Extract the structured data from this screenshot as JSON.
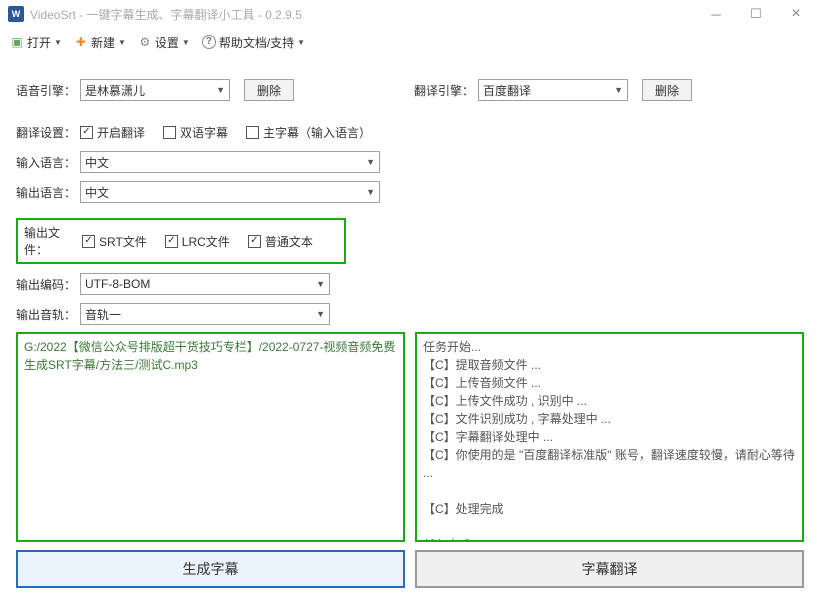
{
  "window": {
    "title": "VideoSrt - 一键字幕生成、字幕翻译小工具 - 0.2.9.5"
  },
  "toolbar": {
    "open": "打开",
    "new_": "新建",
    "settings": "设置",
    "help": "帮助文档/支持"
  },
  "engine": {
    "speech_label": "语音引擎：",
    "speech_value": "是林慕潇儿",
    "delete": "删除",
    "trans_label": "翻译引擎：",
    "trans_value": "百度翻译"
  },
  "translate": {
    "label": "翻译设置：",
    "enable": "开启翻译",
    "bilingual": "双语字幕",
    "main_subtitle": "主字幕（输入语言）"
  },
  "lang": {
    "in_label": "输入语言：",
    "in_value": "中文",
    "out_label": "输出语言：",
    "out_value": "中文"
  },
  "outfile": {
    "label": "输出文件：",
    "srt": "SRT文件",
    "lrc": "LRC文件",
    "plain": "普通文本"
  },
  "encoding": {
    "label": "输出编码：",
    "value": "UTF-8-BOM"
  },
  "track": {
    "label": "输出音轨：",
    "value": "音轨一"
  },
  "input_file": "G:/2022【微信公众号排版超干货技巧专栏】/2022-0727-视频音频免费生成SRT字幕/方法三/测试C.mp3",
  "log": [
    "任务开始...",
    "【C】提取音频文件 ...",
    "【C】上传音频文件 ...",
    "【C】上传文件成功 , 识别中 ...",
    "【C】文件识别成功 , 字幕处理中 ...",
    "【C】字幕翻译处理中 ...",
    "【C】你使用的是 \"百度翻译标准版\" 账号，翻译速度较慢，请耐心等待 ...",
    "",
    "【C】处理完成",
    "",
    "任务完成!"
  ],
  "buttons": {
    "generate": "生成字幕",
    "translate": "字幕翻译"
  }
}
